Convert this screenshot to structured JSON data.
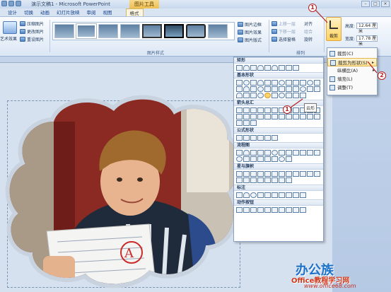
{
  "titlebar": {
    "title": "演示文稿1 - Microsoft PowerPoint",
    "context_tab": "图片工具",
    "min": "–",
    "max": "□",
    "close": "×"
  },
  "tabs": [
    "设计",
    "切换",
    "动画",
    "幻灯片放映",
    "审阅",
    "视图",
    "格式"
  ],
  "ribbon": {
    "artistic_effects": "艺术效果",
    "compress": "压缩图片",
    "change_picture": "更改图片",
    "reset_picture": "重设图片",
    "gallery_group": "图片样式",
    "picture_border": "图片边框",
    "picture_effects": "图片效果",
    "picture_layout": "图片版式",
    "bring_forward": "上移一层",
    "send_backward": "下移一层",
    "selection_pane": "选择窗格",
    "align": "对齐",
    "group": "组合",
    "rotate": "旋转",
    "arrange_group": "排列",
    "crop": "裁剪",
    "height_label": "高度:",
    "height_value": "12.64 厘米",
    "width_label": "宽度:",
    "width_value": "17.78 厘米"
  },
  "shapes_panel": {
    "sections": [
      "矩形",
      "基本形状",
      "箭头总汇",
      "公式形状",
      "流程图",
      "星与旗帜",
      "标注",
      "动作按钮"
    ],
    "tooltip": "云形"
  },
  "crop_menu": {
    "items": [
      "裁剪(C)",
      "裁剪为形状(S)",
      "纵横比(A)",
      "填充(L)",
      "调整(T)"
    ]
  },
  "callouts": [
    "1",
    "2",
    "1"
  ],
  "watermark": {
    "logo": "办公族",
    "site": "Office教程学习网",
    "url": "www.office68.com"
  }
}
